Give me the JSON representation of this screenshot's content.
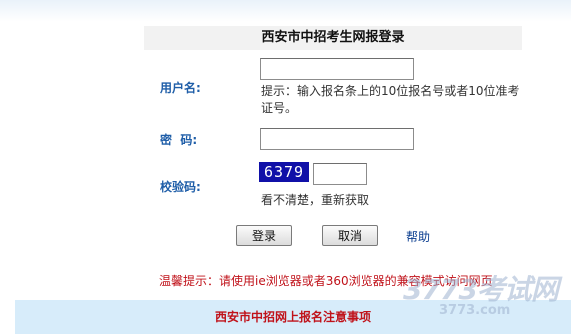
{
  "header": {
    "title": "西安市中招考生网报登录"
  },
  "form": {
    "username_label": "用户名:",
    "username_value": "",
    "username_hint": "提示：输入报名条上的10位报名号或者10位准考证号。",
    "password_label": "密  码:",
    "password_value": "",
    "captcha_label": "校验码:",
    "captcha_code": "6379",
    "captcha_value": "",
    "refresh_text": "看不清楚，重新获取"
  },
  "buttons": {
    "login": "登录",
    "cancel": "取消",
    "help": "帮助"
  },
  "notice": {
    "text": "温馨提示：请使用ie浏览器或者360浏览器的兼容模式访问网页"
  },
  "footer": {
    "title": "西安市中招网上报名注意事项"
  },
  "watermark": {
    "main": "3773考试网",
    "sub": "3773.com"
  },
  "colors": {
    "label_blue": "#1f5ea8",
    "notice_red": "#c0121a",
    "footer_bg": "#d7ecfa",
    "captcha_bg": "#1010a8"
  }
}
